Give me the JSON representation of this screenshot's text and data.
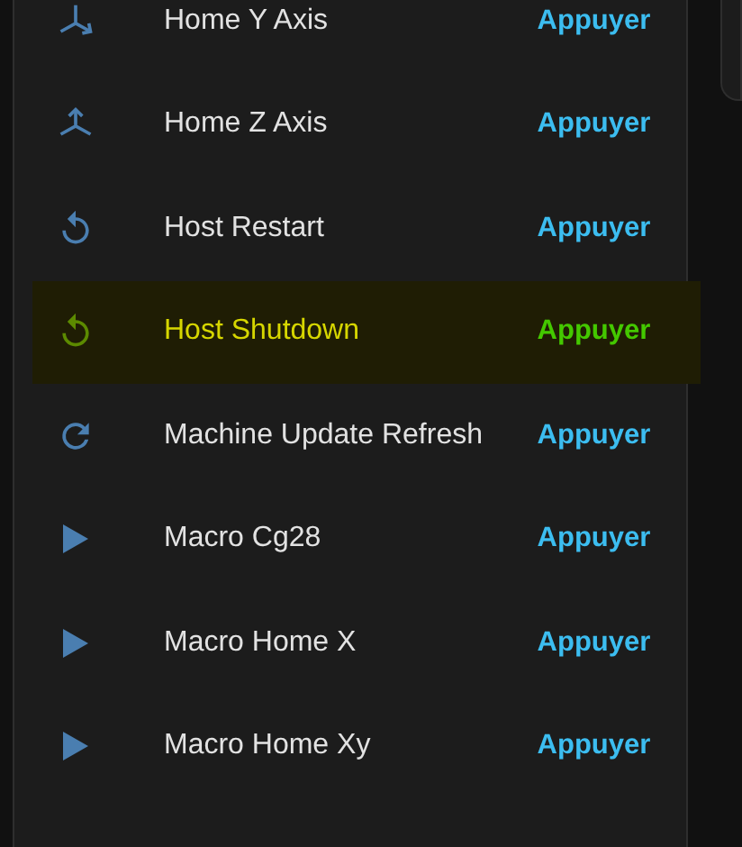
{
  "rows": [
    {
      "kind": "yaxis",
      "label": "Home Y Axis",
      "action": "Appuyer",
      "selected": false
    },
    {
      "kind": "zaxis",
      "label": "Home Z Axis",
      "action": "Appuyer",
      "selected": false
    },
    {
      "kind": "restart",
      "label": "Host Restart",
      "action": "Appuyer",
      "selected": false
    },
    {
      "kind": "restart",
      "label": "Host Shutdown",
      "action": "Appuyer",
      "selected": true
    },
    {
      "kind": "refresh",
      "label": "Machine Update Refresh",
      "action": "Appuyer",
      "selected": false
    },
    {
      "kind": "macro",
      "label": "Macro Cg28",
      "action": "Appuyer",
      "selected": false
    },
    {
      "kind": "macro",
      "label": "Macro Home X",
      "action": "Appuyer",
      "selected": false
    },
    {
      "kind": "macro",
      "label": "Macro Home Xy",
      "action": "Appuyer",
      "selected": false
    }
  ]
}
